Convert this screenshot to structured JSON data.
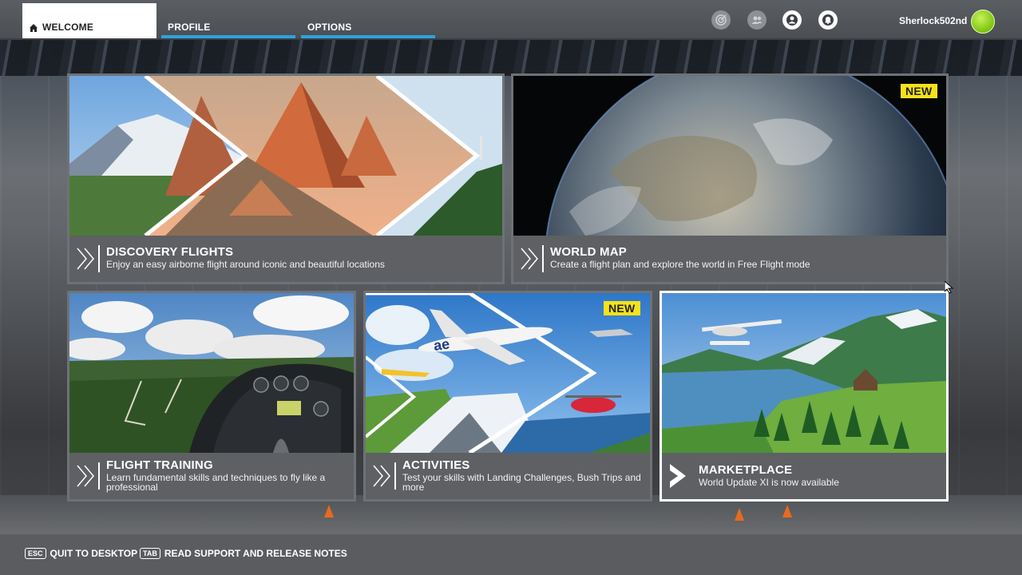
{
  "nav": {
    "tabs": [
      {
        "label": "WELCOME"
      },
      {
        "label": "PROFILE"
      },
      {
        "label": "OPTIONS"
      }
    ]
  },
  "header": {
    "username": "Sherlock502nd",
    "icons": [
      "achievements-icon",
      "friends-icon",
      "profile-icon",
      "notifications-icon"
    ]
  },
  "tiles": {
    "discovery": {
      "title": "DISCOVERY FLIGHTS",
      "desc": "Enjoy an easy airborne flight around iconic and beautiful locations"
    },
    "worldmap": {
      "title": "WORLD MAP",
      "desc": "Create a flight plan and explore the world in Free Flight mode",
      "badge": "NEW"
    },
    "training": {
      "title": "FLIGHT TRAINING",
      "desc": "Learn fundamental skills and techniques to fly like a professional"
    },
    "activities": {
      "title": "ACTIVITIES",
      "desc": "Test your skills with Landing Challenges, Bush Trips and more",
      "badge": "NEW"
    },
    "marketplace": {
      "title": "MARKETPLACE",
      "desc": "World Update XI is now available"
    }
  },
  "footer": {
    "quit": {
      "key": "ESC",
      "label": "QUIT TO DESKTOP"
    },
    "notes": {
      "key": "TAB",
      "label": "READ SUPPORT AND RELEASE NOTES"
    }
  },
  "colors": {
    "accent": "#2ba3dd",
    "badge": "#f5e21a",
    "avatar": "#8bd11a"
  }
}
